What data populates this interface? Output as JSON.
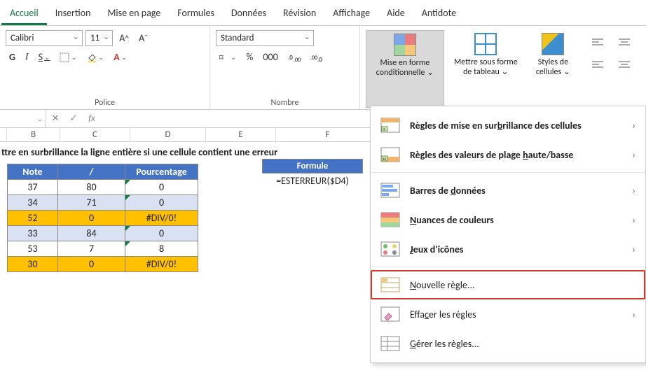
{
  "tabs": [
    "Accueil",
    "Insertion",
    "Mise en page",
    "Formules",
    "Données",
    "Révision",
    "Affichage",
    "Aide",
    "Antidote"
  ],
  "active_tab": 0,
  "font": {
    "name": "Calibri",
    "size": "11",
    "increase": "A^",
    "decrease": "A˅",
    "bold": "G",
    "italic": "I",
    "underline": "S"
  },
  "group_labels": {
    "font": "Police",
    "number": "Nombre"
  },
  "number": {
    "format": "Standard"
  },
  "style_buttons": {
    "cond_format": "Mise en forme conditionnelle",
    "as_table": "Mettre sous forme de tableau",
    "cell_styles": "Styles de cellules"
  },
  "formula_bar": {
    "name_box": "",
    "fx": "fx",
    "value": ""
  },
  "columns": [
    "B",
    "C",
    "D",
    "E",
    "F"
  ],
  "sheet": {
    "title_row": "ttre en surbrillance la ligne entière si une cellule contient une erreur",
    "headers": [
      "Note",
      "/",
      "Pourcentage"
    ],
    "rows": [
      {
        "b": "37",
        "c": "80",
        "d": "0",
        "err": false
      },
      {
        "b": "34",
        "c": "71",
        "d": "0",
        "err": false
      },
      {
        "b": "52",
        "c": "0",
        "d": "#DIV/0!",
        "err": true
      },
      {
        "b": "33",
        "c": "84",
        "d": "0",
        "err": false
      },
      {
        "b": "53",
        "c": "7",
        "d": "8",
        "err": false
      },
      {
        "b": "30",
        "c": "0",
        "d": "#DIV/0!",
        "err": true
      }
    ],
    "formula_header": "Formule",
    "formula_value": "=ESTERREUR($D4)"
  },
  "menu": {
    "items": [
      {
        "label_pre": "Règles de mise en sur",
        "u": "b",
        "label_post": "rillance des cellules",
        "sub": true,
        "icon": "highlight"
      },
      {
        "label_pre": "Règles des valeurs de plage ",
        "u": "h",
        "label_post": "aute/basse",
        "sub": true,
        "icon": "top10"
      },
      {
        "label_pre": "Barres de ",
        "u": "d",
        "label_post": "onnées",
        "sub": true,
        "icon": "databars"
      },
      {
        "label_pre": "",
        "u": "N",
        "label_post": "uances de couleurs",
        "sub": true,
        "icon": "colorscale"
      },
      {
        "label_pre": "",
        "u": "J",
        "label_post": "eux d'icônes",
        "sub": true,
        "icon": "iconset"
      },
      {
        "label_pre": "",
        "u": "N",
        "label_post": "ouvelle règle...",
        "sub": false,
        "icon": "newrule",
        "hl": true
      },
      {
        "label_pre": "Effa",
        "u": "c",
        "label_post": "er les règles",
        "sub": true,
        "icon": "clear"
      },
      {
        "label_pre": "",
        "u": "G",
        "label_post": "érer les règles...",
        "sub": false,
        "icon": "manage"
      }
    ]
  }
}
